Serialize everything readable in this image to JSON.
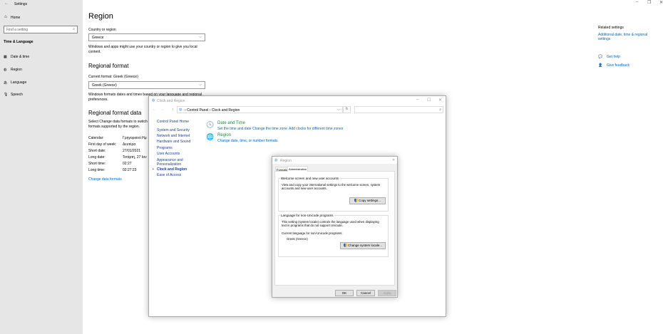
{
  "settings": {
    "title": "Settings",
    "home": "Home",
    "search_placeholder": "Find a setting",
    "section": "Time & Language",
    "nav": [
      {
        "label": "Date & time",
        "icon": "calendar-icon"
      },
      {
        "label": "Region",
        "icon": "globe-icon"
      },
      {
        "label": "Language",
        "icon": "language-icon"
      },
      {
        "label": "Speech",
        "icon": "microphone-icon"
      }
    ],
    "page_title": "Region",
    "country_label": "Country or region",
    "country_value": "Greece",
    "country_desc": [
      "Windows and apps might use your country or region to give you local",
      "content."
    ],
    "regional_format_heading": "Regional format",
    "current_format_label": "Current format: Greek (Greece)",
    "format_value": "Greek (Greece)",
    "format_desc": [
      "Windows formats dates and times based on your language and regional",
      "preferences."
    ],
    "data_heading": "Regional format data",
    "data_desc": [
      "Select Change data formats to switch",
      "formats supported by the region."
    ],
    "rows": [
      {
        "k": "Calendar:",
        "v": "Γρηγοριανό Ημ"
      },
      {
        "k": "First day of week:",
        "v": "Δευτέρα"
      },
      {
        "k": "Short date:",
        "v": "27/01/2021"
      },
      {
        "k": "Long date:",
        "v": "Τετάρτη, 27 Ιαν"
      },
      {
        "k": "Short time:",
        "v": "02:27"
      },
      {
        "k": "Long time:",
        "v": "02:27:23"
      }
    ],
    "change_formats": "Change data formats",
    "related_title": "Related settings",
    "related_link": [
      "Additional date, time & regional",
      "settings"
    ],
    "get_help": "Get help",
    "feedback": "Give feedback"
  },
  "cp": {
    "title": "Clock and Region",
    "crumbs": [
      "Control Panel",
      "Clock and Region"
    ],
    "nav": [
      "Control Panel Home",
      "System and Security",
      "Network and Internet",
      "Hardware and Sound",
      "Programs",
      "User Accounts",
      "Appearance and",
      "Personalization",
      "Clock and Region",
      "Ease of Access"
    ],
    "dt_title": "Date and Time",
    "dt_links": [
      "Set the time and date",
      "Change the time zone",
      "Add clocks for different time zones"
    ],
    "region_title": "Region",
    "region_link": "Change date, time, or number formats"
  },
  "dlg": {
    "title": "Region",
    "tabs": [
      "Formats",
      "Administrative"
    ],
    "g1_title": "Welcome screen and new user accounts",
    "g1_text": [
      "View and copy your international settings to the welcome screen, system",
      "accounts and new user accounts."
    ],
    "copy_btn": "Copy settings...",
    "g2_title": "Language for non-Unicode programs",
    "g2_text": [
      "This setting (system locale) controls the language used when displaying",
      "text in programs that do not support Unicode."
    ],
    "current_label": "Current language for non-Unicode programs:",
    "current_value": "Greek (Greece)",
    "change_btn": "Change system locale...",
    "ok": "OK",
    "cancel": "Cancel",
    "apply": "Apply"
  }
}
